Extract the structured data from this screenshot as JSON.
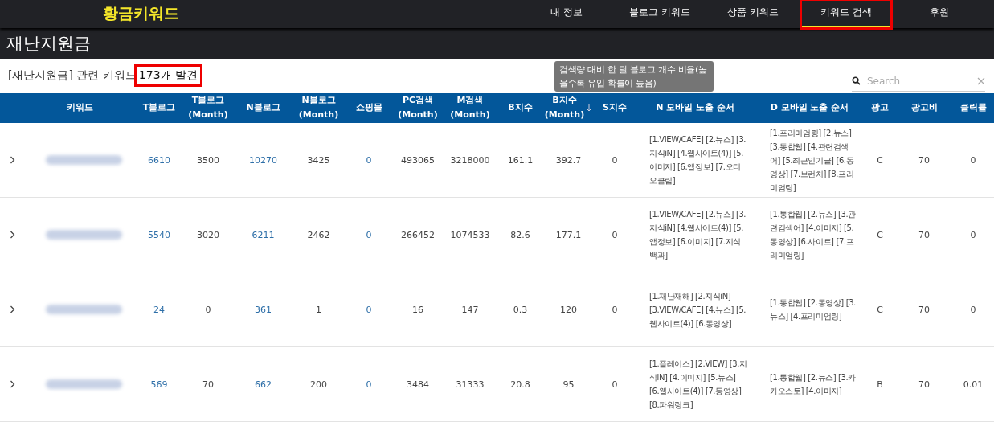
{
  "brand": "황금키워드",
  "nav": [
    {
      "label": "내 정보",
      "selected": false,
      "highlighted": false
    },
    {
      "label": "블로그 키워드",
      "selected": false,
      "highlighted": false
    },
    {
      "label": "상품 키워드",
      "selected": false,
      "highlighted": false
    },
    {
      "label": "키워드 검색",
      "selected": true,
      "highlighted": true
    },
    {
      "label": "후원",
      "selected": false,
      "highlighted": false
    }
  ],
  "page_title": "재난지원금",
  "summary": {
    "prefix": "[재난지원금] 관련 키워드",
    "count": "173개 발견",
    "count_highlighted": true
  },
  "tooltip": "검색량 대비 한 달 블로그 개수 비율(높을수록 유입 확률이 높음)",
  "search": {
    "placeholder": "Search"
  },
  "table": {
    "columns": [
      {
        "label": "키워드",
        "kind": "keyword"
      },
      {
        "label": "T블로그",
        "kind": "link"
      },
      {
        "label": "T블로그",
        "sub": "(Month)",
        "kind": "number"
      },
      {
        "label": "N블로그",
        "kind": "link"
      },
      {
        "label": "N블로그",
        "sub": "(Month)",
        "kind": "number"
      },
      {
        "label": "쇼핑몰",
        "kind": "link"
      },
      {
        "label": "PC검색",
        "sub": "(Month)",
        "kind": "number"
      },
      {
        "label": "M검색",
        "sub": "(Month)",
        "kind": "number"
      },
      {
        "label": "B지수",
        "kind": "number"
      },
      {
        "label": "B지수",
        "sub": "(Month)",
        "kind": "number",
        "sorted": true
      },
      {
        "label": "S지수",
        "kind": "number"
      },
      {
        "label": "N 모바일 노출 순서",
        "kind": "text"
      },
      {
        "label": "D 모바일 노출 순서",
        "kind": "text"
      },
      {
        "label": "광고",
        "kind": "number"
      },
      {
        "label": "광고비",
        "kind": "number"
      },
      {
        "label": "클릭률",
        "kind": "number"
      }
    ],
    "rows": [
      {
        "expanded": false,
        "cells": [
          "",
          "6610",
          "3500",
          "10270",
          "3425",
          "0",
          "493065",
          "3218000",
          "161.1",
          "392.7",
          "0",
          "[1.VIEW/CAFE] [2.뉴스] [3.지식iN] [4.웹사이트(4)] [5.이미지] [6.앱정보] [7.오디오클립]",
          "[1.프리미엄링] [2.뉴스] [3.통합웹] [4.관련검색어] [5.최근인기글] [6.동영상] [7.브런치] [8.프리미엄링]",
          "C",
          "70",
          "0"
        ]
      },
      {
        "expanded": false,
        "cells": [
          "",
          "5540",
          "3020",
          "6211",
          "2462",
          "0",
          "266452",
          "1074533",
          "82.6",
          "177.1",
          "0",
          "[1.VIEW/CAFE] [2.뉴스] [3.지식iN] [4.웹사이트(4)] [5.앱정보] [6.이미지] [7.지식백과]",
          "[1.통합웹] [2.뉴스] [3.관련검색어] [4.이미지] [5.동영상] [6.사이트] [7.프리미엄링]",
          "C",
          "70",
          "0"
        ]
      },
      {
        "expanded": false,
        "cells": [
          "",
          "24",
          "0",
          "361",
          "1",
          "0",
          "16",
          "147",
          "0.3",
          "120",
          "0",
          "[1.재난재해] [2.지식iN] [3.VIEW/CAFE] [4.뉴스] [5.웹사이트(4)] [6.동영상]",
          "[1.통합웹] [2.동영상] [3.뉴스] [4.프리미엄링]",
          "C",
          "70",
          "0"
        ]
      },
      {
        "expanded": false,
        "cells": [
          "",
          "569",
          "70",
          "662",
          "200",
          "0",
          "3484",
          "31333",
          "20.8",
          "95",
          "0",
          "[1.플레이스] [2.VIEW] [3.지식iN] [4.이미지] [5.뉴스] [6.웹사이트(4)] [7.동영상] [8.파워링크]",
          "[1.통합웹] [2.뉴스] [3.카카오스토] [4.이미지]",
          "B",
          "70",
          "0.01"
        ]
      }
    ]
  }
}
